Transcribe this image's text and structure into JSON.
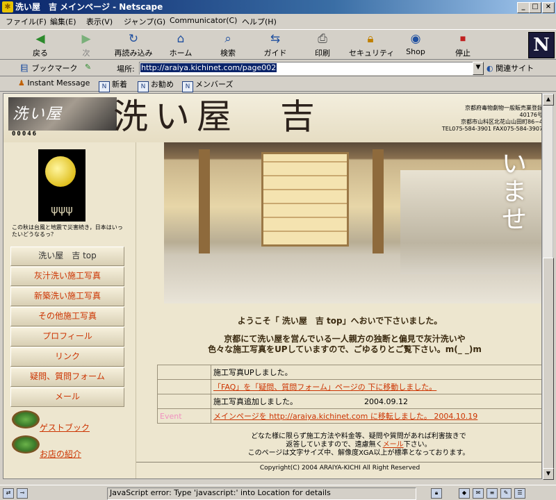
{
  "window": {
    "title": "洗い屋　吉 メインページ - Netscape",
    "minimize": "_",
    "maximize": "□",
    "close": "×"
  },
  "menu": [
    "ファイル(F)",
    "編集(E)",
    "表示(V)",
    "ジャンプ(G)",
    "Communicator(C)",
    "ヘルプ(H)"
  ],
  "toolbar": {
    "back": "戻る",
    "forward": "次",
    "reload": "再読み込み",
    "home": "ホーム",
    "search": "検索",
    "guide": "ガイド",
    "print": "印刷",
    "security": "セキュリティ",
    "shop": "Shop",
    "stop": "停止",
    "logo": "N"
  },
  "location": {
    "bookmarks": "ブックマーク",
    "label": "場所:",
    "url": "http://araiya.kichinet.com/page002",
    "related": "関連サイト"
  },
  "personal": {
    "instant_message": "Instant Message",
    "new": "新着",
    "recommend": "お勧め",
    "members": "メンバーズ"
  },
  "banner": {
    "logo_text": "洗い屋",
    "counter": "00046",
    "title": "洗い屋　吉",
    "license": [
      "京都府毒物劇物一般販売業登録",
      "40176号",
      "京都市山科区北花山山田町86−4",
      "TEL075-584-3901 FAX075-584-3907"
    ]
  },
  "sidebar": {
    "moon_caption": "この秋は台風と地震で災害続き，日本はいったいどうなるっ？",
    "nav": [
      {
        "label": "洗い屋　吉 top"
      },
      {
        "label": "灰汁洗い施工写真"
      },
      {
        "label": "新築洗い施工写真"
      },
      {
        "label": "その他施工写真"
      },
      {
        "label": "プロフィール"
      },
      {
        "label": "リンク"
      },
      {
        "label": "疑問、質問フォーム"
      },
      {
        "label": "メール"
      }
    ],
    "guestbook": "ゲストブック",
    "shop_intro": "お店の紹介"
  },
  "main": {
    "photo_text": "いませ",
    "welcome": "ようこそ「 洗い屋　吉 top」へおいで下さいました。",
    "intro_1": "京都にて洗い屋を営んでいる一人親方の独断と偏見で灰汁洗いや",
    "intro_2": "色々な施工写真をUPしていますので、ごゆるりとご覧下さい。m(_ _)m",
    "news": [
      {
        "tag": "",
        "text": "施工写真UPしました。",
        "date": ""
      },
      {
        "tag": "",
        "text": "「FAQ」を「疑問、質問フォーム」ページの 下に移動しました。",
        "date": ""
      },
      {
        "tag": "",
        "text": "施工写真追加しました。",
        "date": "2004.09.12"
      },
      {
        "tag": "Event",
        "text": "メインページを  http://araiya.kichinet.com  に移転しました。 2004.10.19",
        "date": ""
      }
    ],
    "footnote_1": "どなた様に限らず施工方法や料金等、疑問や質問があれば利害抜きで",
    "footnote_2a": "返答していますので、遠慮無く",
    "footnote_mail": "メール",
    "footnote_2b": "下さい。",
    "footnote_3": "このページは文字サイズ中、解像度XGA以上が標準となっております。",
    "copyright": "Copyright(C) 2004 ARAIYA-KICHI All Right Reserved"
  },
  "status": {
    "text": "JavaScript error: Type 'javascript:' into Location for details"
  }
}
